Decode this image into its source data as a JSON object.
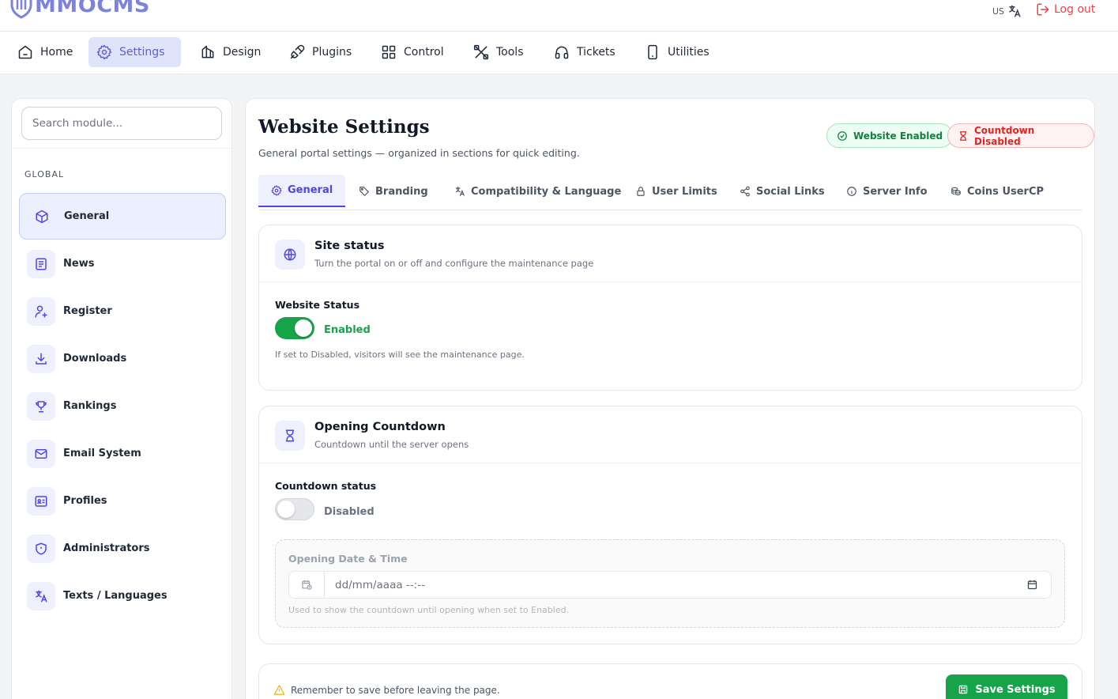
{
  "app": {
    "logo_text": "MMOCMS"
  },
  "topbar": {
    "language": "US",
    "logout_label": "Log out"
  },
  "nav": {
    "items": [
      {
        "label": "Home",
        "icon": "home-icon"
      },
      {
        "label": "Settings",
        "icon": "gear-icon",
        "active": true
      },
      {
        "label": "Design",
        "icon": "design-icon"
      },
      {
        "label": "Plugins",
        "icon": "plug-icon"
      },
      {
        "label": "Control",
        "icon": "grid-icon"
      },
      {
        "label": "Tools",
        "icon": "tools-icon"
      },
      {
        "label": "Tickets",
        "icon": "headset-icon"
      },
      {
        "label": "Utilities",
        "icon": "phone-icon"
      }
    ]
  },
  "sidebar": {
    "search_placeholder": "Search module...",
    "section": "GLOBAL",
    "items": [
      {
        "label": "General",
        "icon": "cube-icon",
        "active": true
      },
      {
        "label": "News",
        "icon": "newspaper-icon"
      },
      {
        "label": "Register",
        "icon": "user-plus-icon"
      },
      {
        "label": "Downloads",
        "icon": "download-icon"
      },
      {
        "label": "Rankings",
        "icon": "trophy-icon"
      },
      {
        "label": "Email System",
        "icon": "mail-icon"
      },
      {
        "label": "Profiles",
        "icon": "id-card-icon"
      },
      {
        "label": "Administrators",
        "icon": "shield-icon"
      },
      {
        "label": "Texts / Languages",
        "icon": "translate-icon"
      }
    ]
  },
  "page": {
    "title": "Website Settings",
    "subtitle": "General portal settings — organized in sections for quick editing.",
    "badges": {
      "website": "Website Enabled",
      "countdown": "Countdown Disabled"
    }
  },
  "tabs": [
    {
      "label": "General",
      "icon": "gear-icon",
      "active": true
    },
    {
      "label": "Branding",
      "icon": "tag-icon"
    },
    {
      "label": "Compatibility & Language",
      "icon": "translate-icon"
    },
    {
      "label": "User Limits",
      "icon": "lock-icon"
    },
    {
      "label": "Social Links",
      "icon": "share-icon"
    },
    {
      "label": "Server Info",
      "icon": "info-icon"
    },
    {
      "label": "Coins UserCP",
      "icon": "coins-icon"
    }
  ],
  "site_status": {
    "title": "Site status",
    "subtitle": "Turn the portal on or off and configure the maintenance page",
    "field_label": "Website Status",
    "toggle_on": true,
    "toggle_text": "Enabled",
    "hint": "If set to Disabled, visitors will see the maintenance page."
  },
  "countdown": {
    "title": "Opening Countdown",
    "subtitle": "Countdown until the server opens",
    "field_label": "Countdown status",
    "toggle_on": false,
    "toggle_text": "Disabled",
    "date_label": "Opening Date & Time",
    "date_placeholder": "dd/mm/aaaa --:--",
    "date_hint": "Used to show the countdown until opening when set to Enabled."
  },
  "footer": {
    "warning": "Remember to save before leaving the page.",
    "save_label": "Save Settings"
  },
  "colors": {
    "accent": "#4f46e5",
    "success": "#16a34a",
    "danger": "#dc2626",
    "logo": "#7c83dc"
  }
}
